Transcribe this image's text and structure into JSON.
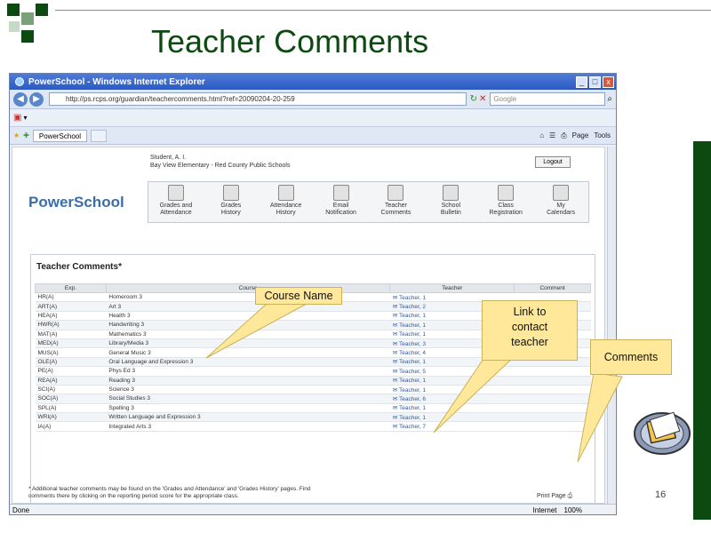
{
  "slide": {
    "title": "Teacher Comments",
    "slide_number": "16",
    "accent": "#0d4a12"
  },
  "browser": {
    "window_title": "PowerSchool - Windows Internet Explorer",
    "address": "http://ps.rcps.org/guardian/teachercomments.html?ref=20090204-20-259",
    "search_placeholder": "Google",
    "tab_label": "PowerSchool",
    "tools": [
      "Page",
      "Tools"
    ],
    "status_left": "Done",
    "status_zone": "Internet",
    "status_zoom": "100%"
  },
  "powerschool": {
    "logo": "PowerSchool",
    "student_line1": "Student, A. I.",
    "student_line2": "Bay View Elementary - Red County Public Schools",
    "logout": "Logout",
    "nav": [
      {
        "line1": "Grades and",
        "line2": "Attendance"
      },
      {
        "line1": "Grades",
        "line2": "History"
      },
      {
        "line1": "Attendance",
        "line2": "History"
      },
      {
        "line1": "Email",
        "line2": "Notification"
      },
      {
        "line1": "Teacher",
        "line2": "Comments"
      },
      {
        "line1": "School",
        "line2": "Bulletin"
      },
      {
        "line1": "Class",
        "line2": "Registration"
      },
      {
        "line1": "My",
        "line2": "Calendars"
      }
    ],
    "panel_title": "Teacher Comments*",
    "columns": [
      "Exp.",
      "Course",
      "Teacher",
      "Comment"
    ],
    "rows": [
      {
        "exp": "HR(A)",
        "course": "Homeroom 3",
        "teacher": "Teacher, 1"
      },
      {
        "exp": "ART(A)",
        "course": "Art 3",
        "teacher": "Teacher, 2"
      },
      {
        "exp": "HEA(A)",
        "course": "Health 3",
        "teacher": "Teacher, 1"
      },
      {
        "exp": "HWR(A)",
        "course": "Handwriting 3",
        "teacher": "Teacher, 1"
      },
      {
        "exp": "MAT(A)",
        "course": "Mathematics 3",
        "teacher": "Teacher, 1"
      },
      {
        "exp": "MED(A)",
        "course": "Library/Media 3",
        "teacher": "Teacher, 3"
      },
      {
        "exp": "MUS(A)",
        "course": "General Music 3",
        "teacher": "Teacher, 4"
      },
      {
        "exp": "OLE(A)",
        "course": "Oral Language and Expression 3",
        "teacher": "Teacher, 1"
      },
      {
        "exp": "PE(A)",
        "course": "Phys Ed 3",
        "teacher": "Teacher, 5"
      },
      {
        "exp": "REA(A)",
        "course": "Reading 3",
        "teacher": "Teacher, 1"
      },
      {
        "exp": "SCI(A)",
        "course": "Science 3",
        "teacher": "Teacher, 1"
      },
      {
        "exp": "SOC(A)",
        "course": "Social Studies 3",
        "teacher": "Teacher, 6"
      },
      {
        "exp": "SPL(A)",
        "course": "Spelling 3",
        "teacher": "Teacher, 1"
      },
      {
        "exp": "WRI(A)",
        "course": "Written Language and Expression 3",
        "teacher": "Teacher, 1"
      },
      {
        "exp": "IA(A)",
        "course": "Integrated Arts 3",
        "teacher": "Teacher, 7"
      }
    ],
    "footnote_line1": "* Additional teacher comments may be found on the 'Grades and Attendance' and 'Grades History' pages. Find",
    "footnote_line2": "comments there by clicking on the reporting period score for the appropriate class.",
    "print_page": "Print Page"
  },
  "callouts": {
    "course_name": "Course Name",
    "link_line1": "Link to",
    "link_line2": "contact",
    "link_line3": "teacher",
    "comments": "Comments"
  },
  "colors": {
    "callout_fill": "#ffe89a",
    "logo_blue": "#3a6ea8"
  }
}
